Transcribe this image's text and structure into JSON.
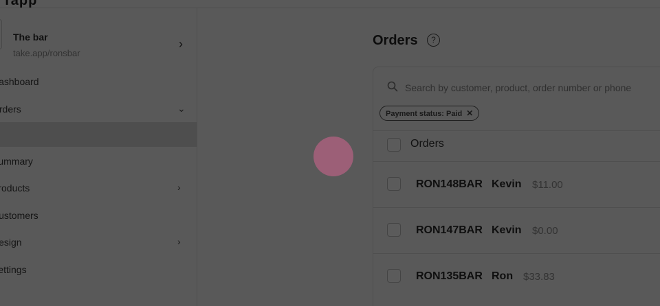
{
  "app": {
    "logo_text": "Tapp"
  },
  "store": {
    "name": "The bar",
    "url": "take.app/ronsbar"
  },
  "sidebar": {
    "items": [
      {
        "label": "Dashboard",
        "chevron": ""
      },
      {
        "label": "Orders",
        "chevron": "⌄"
      },
      {
        "label": "",
        "chevron": ""
      },
      {
        "label": "Summary",
        "chevron": ""
      },
      {
        "label": "Products",
        "chevron": "›"
      },
      {
        "label": "Customers",
        "chevron": ""
      },
      {
        "label": "Design",
        "chevron": "›"
      },
      {
        "label": "Settings",
        "chevron": ""
      }
    ]
  },
  "main": {
    "title": "Orders",
    "search_placeholder": "Search by customer, product, order number or phone",
    "filter_chip": "Payment status: Paid",
    "table_header": "Orders",
    "orders": [
      {
        "id": "RON148BAR",
        "customer": "Kevin",
        "amount": "$11.00"
      },
      {
        "id": "RON147BAR",
        "customer": "Kevin",
        "amount": "$0.00"
      },
      {
        "id": "RON135BAR",
        "customer": "Ron",
        "amount": "$33.83"
      }
    ]
  },
  "colors": {
    "overlay": "#595959",
    "cursor": "#a06079"
  },
  "icons": [
    "chevron-right-icon",
    "help-icon",
    "search-icon",
    "close-icon",
    "chevron-down-icon"
  ]
}
